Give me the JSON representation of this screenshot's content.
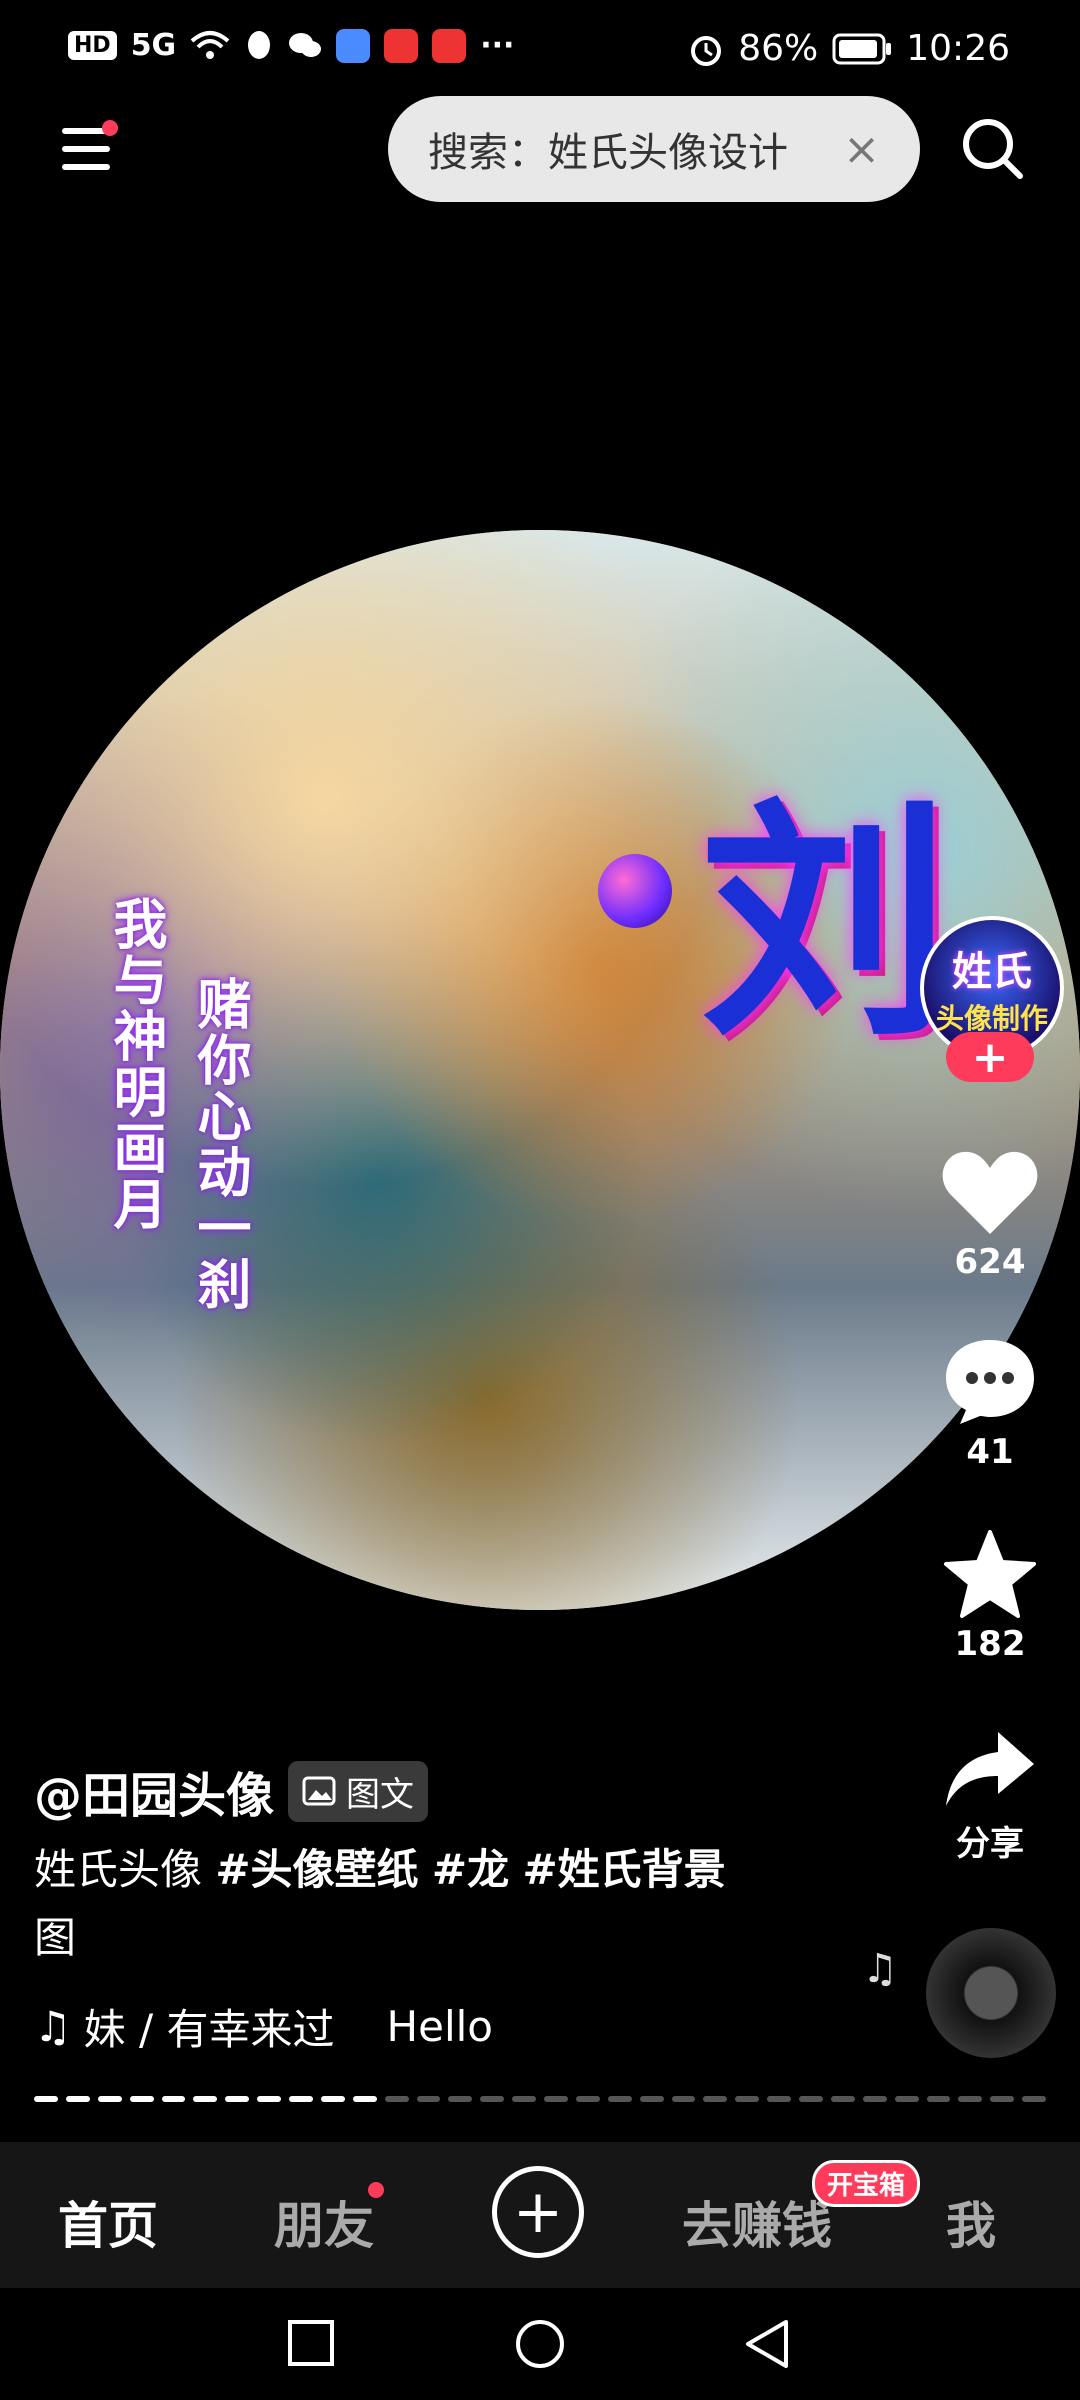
{
  "status_bar": {
    "left_chip": "HD",
    "signal": "5G",
    "more": "···",
    "alarm_icon": "alarm-icon",
    "battery": "86%",
    "time": "10:26"
  },
  "top_bar": {
    "search_text": "搜索：姓氏头像设计",
    "search_clear": "×"
  },
  "image": {
    "big_char": "刘",
    "vertical_left": "我与神明画月",
    "vertical_right": "赌你心动一刹",
    "avatar_line1": "姓氏",
    "avatar_line2": "头像制作"
  },
  "rail": {
    "likes": "624",
    "comments": "41",
    "favorites": "182",
    "share": "分享",
    "follow": "+"
  },
  "post": {
    "author": "@田园头像",
    "type_chip": "图文",
    "desc_plain": "姓氏头像 ",
    "hashtags": [
      "#头像壁纸",
      "#龙",
      "#姓氏背景"
    ],
    "desc_tail": "图",
    "music_text": "妹 / 有幸来过",
    "music_extra": "Hello"
  },
  "progress": {
    "segments": 32,
    "active": 11
  },
  "bottom_nav": {
    "home": "首页",
    "friends": "朋友",
    "create": "+",
    "earn": "去赚钱",
    "earn_badge": "开宝箱",
    "me": "我"
  },
  "colors": {
    "accent": "#ff3b5c",
    "nav_bg": "#161616"
  }
}
